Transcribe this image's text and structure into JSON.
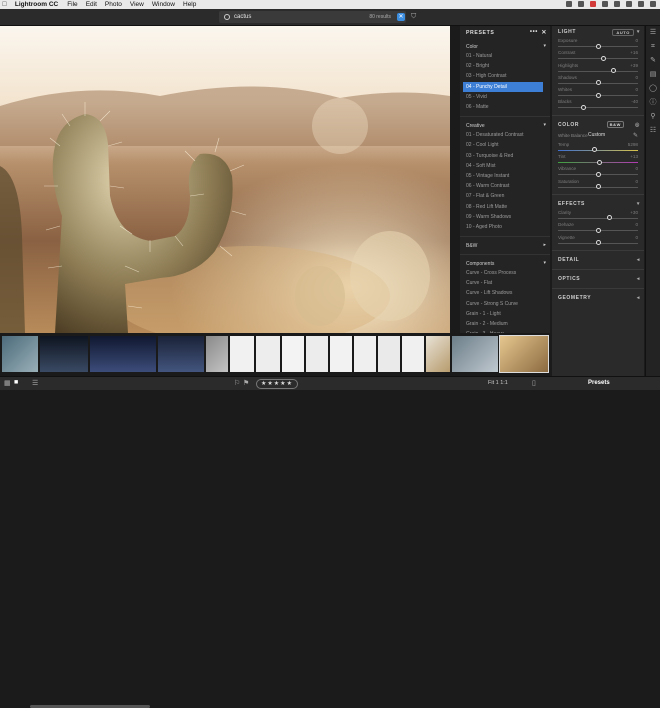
{
  "menubar": {
    "apple": "",
    "app": "Lightroom CC",
    "items": [
      "File",
      "Edit",
      "Photo",
      "View",
      "Window",
      "Help"
    ]
  },
  "search": {
    "value": "cactus",
    "count": "80 results"
  },
  "presets": {
    "title": "PRESETS",
    "groups": [
      {
        "name": "Color",
        "items": [
          "01 - Natural",
          "02 - Bright",
          "03 - High Contrast",
          "04 - Punchy Detail",
          "05 - Vivid",
          "06 - Matte"
        ],
        "selected": 3
      },
      {
        "name": "Creative",
        "items": [
          "01 - Desaturated Contrast",
          "02 - Cool Light",
          "03 - Turquoise & Red",
          "04 - Soft Mist",
          "05 - Vintage Instant",
          "06 - Warm Contrast",
          "07 - Flat & Green",
          "08 - Red Lift Matte",
          "09 - Warm Shadows",
          "10 - Aged Photo"
        ]
      },
      {
        "name": "B&W",
        "items": []
      },
      {
        "name": "Components",
        "items": [
          "Curve - Cross Process",
          "Curve - Flat",
          "Curve - Lift Shadows",
          "Curve - Strong S Curve",
          "Grain - 1 - Light",
          "Grain - 2 - Medium",
          "Grain - 3 - Heavy"
        ]
      }
    ]
  },
  "light": {
    "title": "LIGHT",
    "auto": "AUTO",
    "sliders": [
      {
        "label": "Exposure",
        "value": "0",
        "pos": 0.5
      },
      {
        "label": "Contrast",
        "value": "+16",
        "pos": 0.58
      },
      {
        "label": "Highlights",
        "value": "+39",
        "pos": 0.7
      },
      {
        "label": "Shadows",
        "value": "0",
        "pos": 0.5
      },
      {
        "label": "Whites",
        "value": "0",
        "pos": 0.5
      },
      {
        "label": "Blacks",
        "value": "-40",
        "pos": 0.3
      }
    ]
  },
  "color": {
    "title": "COLOR",
    "bw": "B&W",
    "wb_label": "White Balance",
    "wb_value": "Custom",
    "sliders": [
      {
        "label": "Temp",
        "value": "5298",
        "pos": 0.45,
        "cls": "temp"
      },
      {
        "label": "Tint",
        "value": "+13",
        "pos": 0.52,
        "cls": "tint"
      },
      {
        "label": "Vibrance",
        "value": "0",
        "pos": 0.5,
        "cls": ""
      },
      {
        "label": "Saturation",
        "value": "0",
        "pos": 0.5,
        "cls": ""
      }
    ]
  },
  "effects": {
    "title": "EFFECTS",
    "sliders": [
      {
        "label": "Clarity",
        "value": "+30",
        "pos": 0.65
      },
      {
        "label": "Dehaze",
        "value": "0",
        "pos": 0.5
      },
      {
        "label": "Vignette",
        "value": "0",
        "pos": 0.5
      }
    ]
  },
  "sections": [
    "DETAIL",
    "OPTICS",
    "GEOMETRY"
  ],
  "bottom": {
    "rating": "★★★★★",
    "fit": "Fit 1 1:1",
    "presets_label": "Presets"
  }
}
